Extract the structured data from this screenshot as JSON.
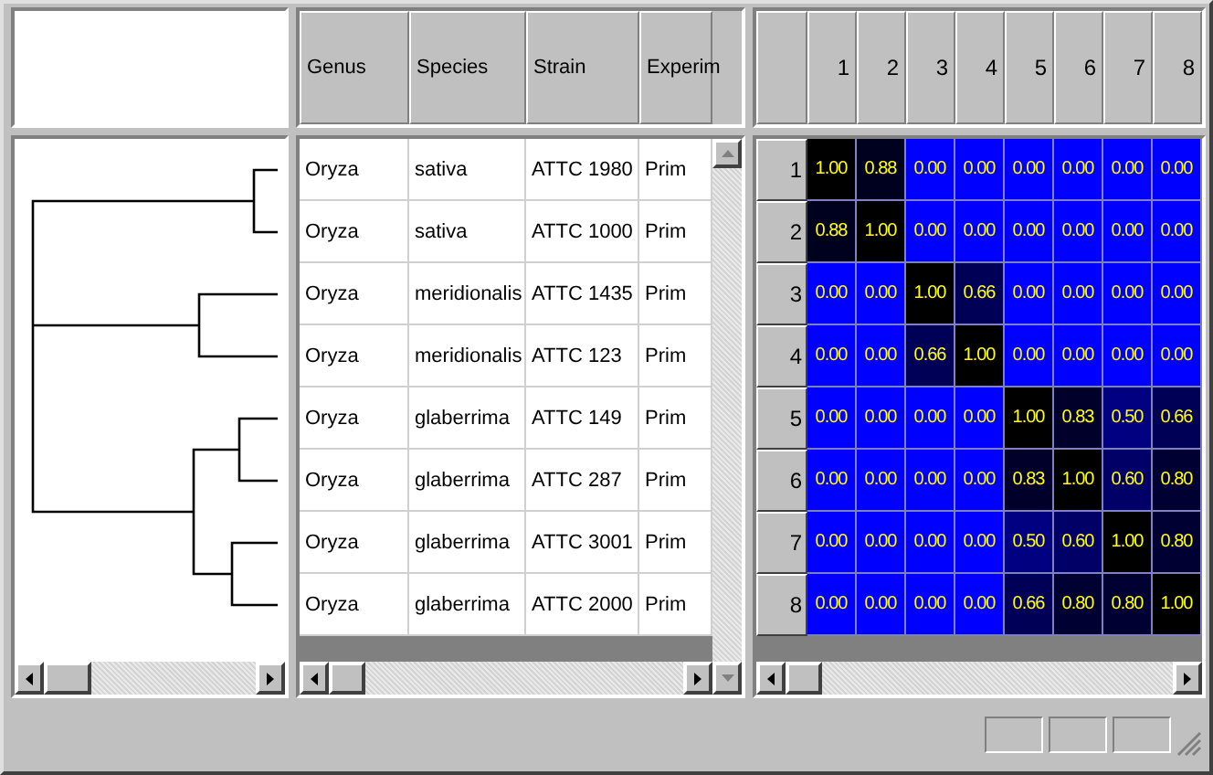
{
  "table": {
    "columns": [
      "Genus",
      "Species",
      "Strain",
      "Experim"
    ],
    "rows": [
      [
        "Oryza",
        "sativa",
        "ATTC 1980",
        "Prim"
      ],
      [
        "Oryza",
        "sativa",
        "ATTC 1000",
        "Prim"
      ],
      [
        "Oryza",
        "meridionalis",
        "ATTC 1435",
        "Prim"
      ],
      [
        "Oryza",
        "meridionalis",
        "ATTC 123",
        "Prim"
      ],
      [
        "Oryza",
        "glaberrima",
        "ATTC 149",
        "Prim"
      ],
      [
        "Oryza",
        "glaberrima",
        "ATTC 287",
        "Prim"
      ],
      [
        "Oryza",
        "glaberrima",
        "ATTC 3001",
        "Prim"
      ],
      [
        "Oryza",
        "glaberrima",
        "ATTC 2000",
        "Prim"
      ]
    ]
  },
  "matrix": {
    "columns": [
      "1",
      "2",
      "3",
      "4",
      "5",
      "6",
      "7",
      "8"
    ],
    "rows": [
      {
        "label": "1",
        "cells": [
          "1.00",
          "0.88",
          "0.00",
          "0.00",
          "0.00",
          "0.00",
          "0.00",
          "0.00"
        ]
      },
      {
        "label": "2",
        "cells": [
          "0.88",
          "1.00",
          "0.00",
          "0.00",
          "0.00",
          "0.00",
          "0.00",
          "0.00"
        ]
      },
      {
        "label": "3",
        "cells": [
          "0.00",
          "0.00",
          "1.00",
          "0.66",
          "0.00",
          "0.00",
          "0.00",
          "0.00"
        ]
      },
      {
        "label": "4",
        "cells": [
          "0.00",
          "0.00",
          "0.66",
          "1.00",
          "0.00",
          "0.00",
          "0.00",
          "0.00"
        ]
      },
      {
        "label": "5",
        "cells": [
          "0.00",
          "0.00",
          "0.00",
          "0.00",
          "1.00",
          "0.83",
          "0.50",
          "0.66"
        ]
      },
      {
        "label": "6",
        "cells": [
          "0.00",
          "0.00",
          "0.00",
          "0.00",
          "0.83",
          "1.00",
          "0.60",
          "0.80"
        ]
      },
      {
        "label": "7",
        "cells": [
          "0.00",
          "0.00",
          "0.00",
          "0.00",
          "0.50",
          "0.60",
          "1.00",
          "0.80"
        ]
      },
      {
        "label": "8",
        "cells": [
          "0.00",
          "0.00",
          "0.00",
          "0.00",
          "0.66",
          "0.80",
          "0.80",
          "1.00"
        ]
      }
    ]
  }
}
